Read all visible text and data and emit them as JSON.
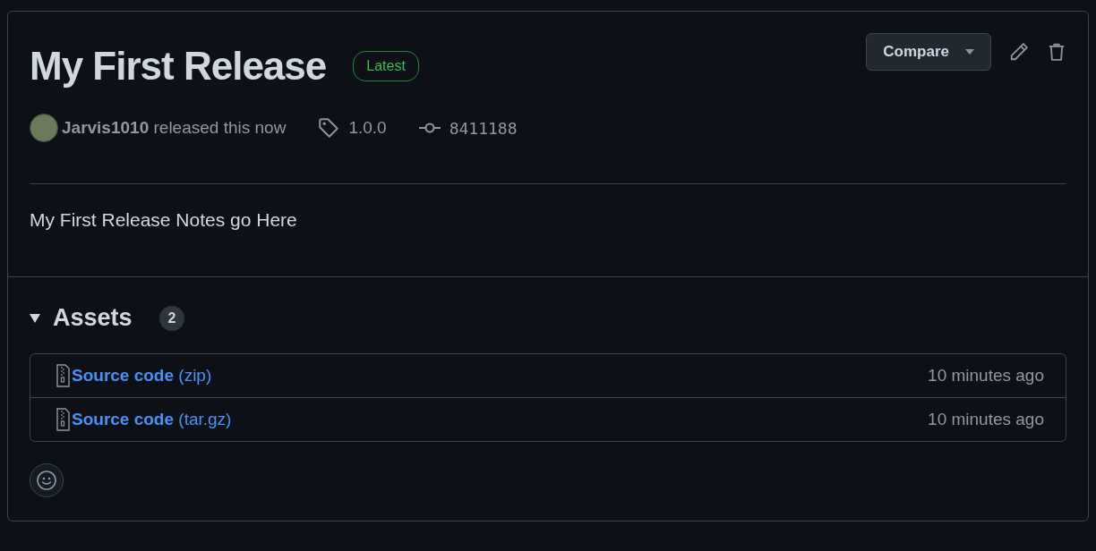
{
  "release": {
    "title": "My First Release",
    "badge": "Latest",
    "author": "Jarvis1010",
    "action": "released this now",
    "tag": "1.0.0",
    "commit": "8411188",
    "notes": "My First Release Notes go Here"
  },
  "actions": {
    "compare": "Compare"
  },
  "assets": {
    "heading": "Assets",
    "count": "2",
    "expanded": true,
    "items": [
      {
        "name": "**Source code** (zip)",
        "time": "10 minutes ago"
      },
      {
        "name": "**Source code** (tar.gz)",
        "time": "10 minutes ago"
      }
    ]
  }
}
